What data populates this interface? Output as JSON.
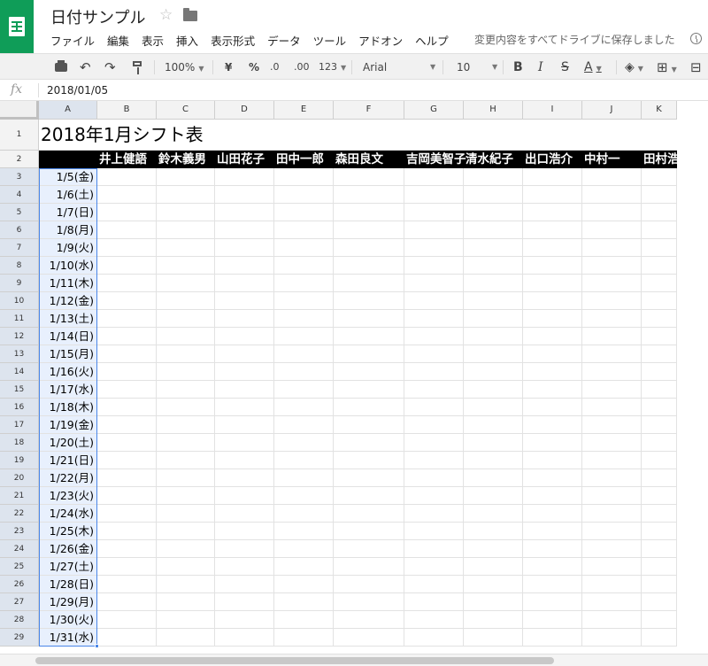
{
  "header": {
    "title": "日付サンプル",
    "save_status": "変更内容をすべてドライブに保存しました"
  },
  "menu": [
    "ファイル",
    "編集",
    "表示",
    "挿入",
    "表示形式",
    "データ",
    "ツール",
    "アドオン",
    "ヘルプ"
  ],
  "toolbar": {
    "zoom": "100%",
    "currency": "¥",
    "percent": "%",
    "decimal_decrease": ".0",
    "decimal_increase": ".00",
    "more_formats": "123",
    "font": "Arial",
    "font_size": "10",
    "bold": "B",
    "italic": "I",
    "strike": "S",
    "text_color": "A"
  },
  "formula_bar": {
    "fx": "fx",
    "value": "2018/01/05"
  },
  "columns": [
    "A",
    "B",
    "C",
    "D",
    "E",
    "F",
    "G",
    "H",
    "I",
    "J",
    "K"
  ],
  "rows": [
    "1",
    "2",
    "3",
    "4",
    "5",
    "6",
    "7",
    "8",
    "9",
    "10",
    "11",
    "12",
    "13",
    "14",
    "15",
    "16",
    "17",
    "18",
    "19",
    "20",
    "21",
    "22",
    "23",
    "24",
    "25",
    "26",
    "27",
    "28",
    "29"
  ],
  "sheet": {
    "title": "2018年1月シフト表",
    "names": [
      "井上健語",
      "鈴木義男",
      "山田花子",
      "田中一郎",
      "森田良文",
      "吉岡美智子",
      "清水紀子",
      "出口浩介",
      "中村一",
      "田村浩一"
    ],
    "dates": [
      "1/5(金)",
      "1/6(土)",
      "1/7(日)",
      "1/8(月)",
      "1/9(火)",
      "1/10(水)",
      "1/11(木)",
      "1/12(金)",
      "1/13(土)",
      "1/14(日)",
      "1/15(月)",
      "1/16(火)",
      "1/17(水)",
      "1/18(木)",
      "1/19(金)",
      "1/20(土)",
      "1/21(日)",
      "1/22(月)",
      "1/23(火)",
      "1/24(水)",
      "1/25(木)",
      "1/26(金)",
      "1/27(土)",
      "1/28(日)",
      "1/29(月)",
      "1/30(火)",
      "1/31(水)"
    ]
  },
  "colors": {
    "brand": "#0f9d58",
    "selection": "#4a86e8",
    "selection_fill": "#e8f0fd"
  }
}
